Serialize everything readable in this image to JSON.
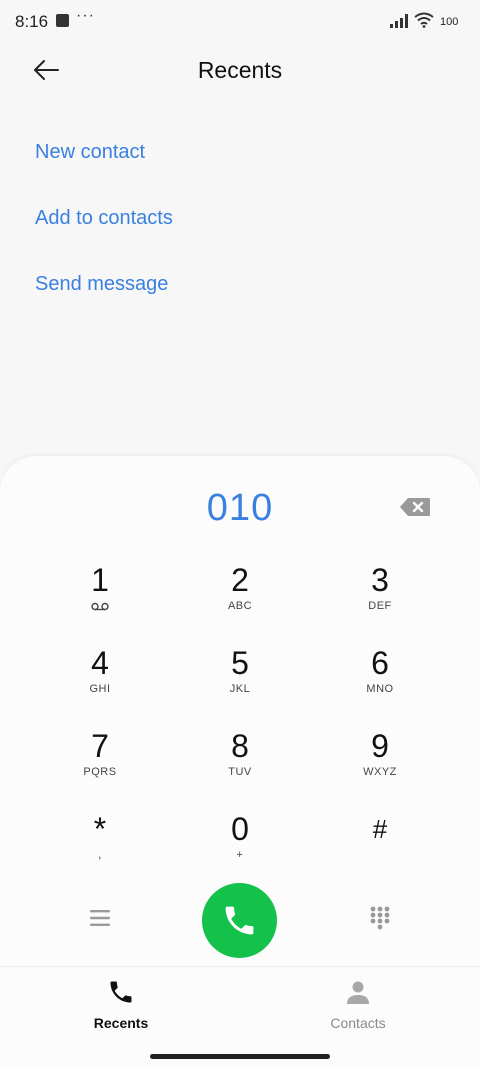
{
  "status_bar": {
    "time": "8:16",
    "overflow": "···",
    "battery": "100"
  },
  "header": {
    "title": "Recents"
  },
  "actions": {
    "new_contact": "New contact",
    "add_to_contacts": "Add to contacts",
    "send_message": "Send message"
  },
  "dialer": {
    "number": "010",
    "keys": [
      {
        "digit": "1",
        "sub": ""
      },
      {
        "digit": "2",
        "sub": "ABC"
      },
      {
        "digit": "3",
        "sub": "DEF"
      },
      {
        "digit": "4",
        "sub": "GHI"
      },
      {
        "digit": "5",
        "sub": "JKL"
      },
      {
        "digit": "6",
        "sub": "MNO"
      },
      {
        "digit": "7",
        "sub": "PQRS"
      },
      {
        "digit": "8",
        "sub": "TUV"
      },
      {
        "digit": "9",
        "sub": "WXYZ"
      },
      {
        "digit": "*",
        "sub": ","
      },
      {
        "digit": "0",
        "sub": "+"
      },
      {
        "digit": "#",
        "sub": ""
      }
    ],
    "call_color": "#14c14a",
    "number_color": "#3a80e0"
  },
  "bottom_nav": {
    "recents": "Recents",
    "contacts": "Contacts"
  }
}
